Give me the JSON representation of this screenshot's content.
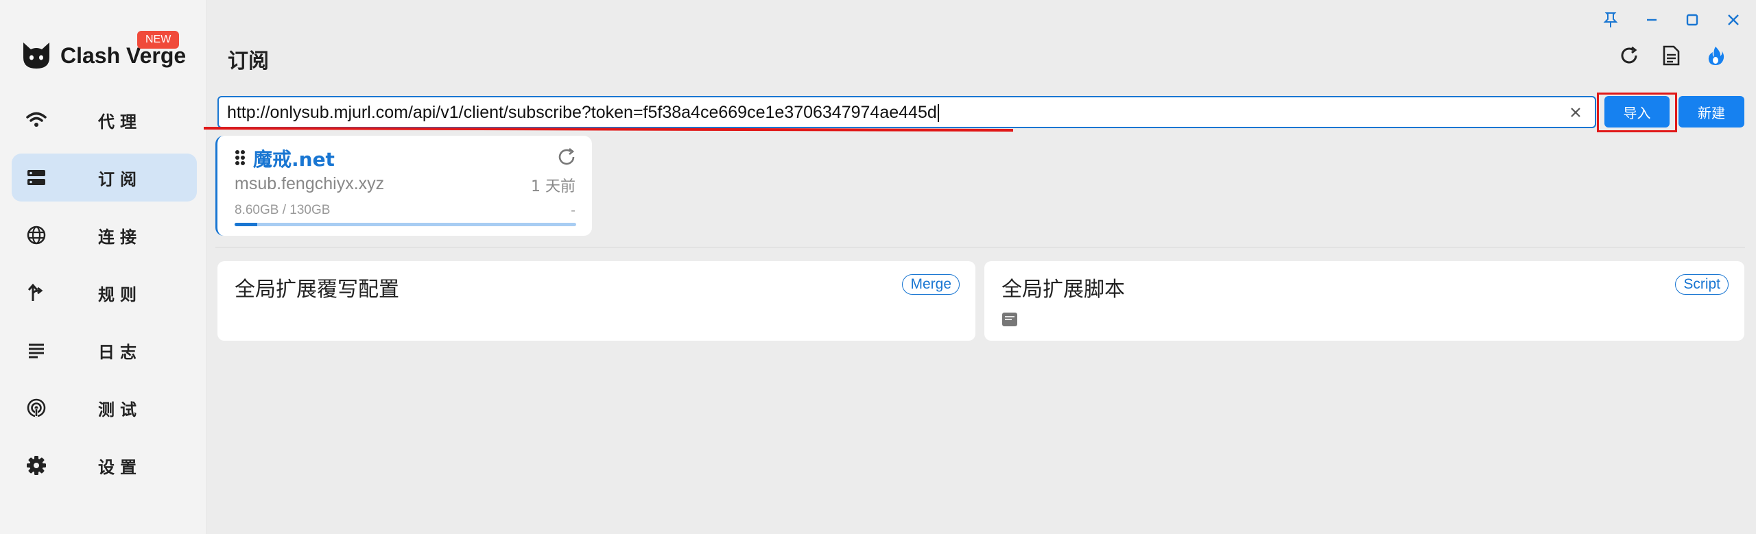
{
  "app": {
    "name": "Clash Verge",
    "new_badge": "NEW"
  },
  "sidebar": {
    "items": [
      {
        "label": "代理",
        "icon": "wifi-icon",
        "active": false
      },
      {
        "label": "订阅",
        "icon": "storage-icon",
        "active": true
      },
      {
        "label": "连接",
        "icon": "globe-icon",
        "active": false
      },
      {
        "label": "规则",
        "icon": "fork-arrow-icon",
        "active": false
      },
      {
        "label": "日志",
        "icon": "list-lines-icon",
        "active": false
      },
      {
        "label": "测试",
        "icon": "radar-icon",
        "active": false
      },
      {
        "label": "设置",
        "icon": "gear-icon",
        "active": false
      }
    ]
  },
  "header": {
    "title": "订阅"
  },
  "url_bar": {
    "value": "http://onlysub.mjurl.com/api/v1/client/subscribe?token=f5f38a4ce669ce1e3706347974ae445d",
    "import_label": "导入",
    "new_label": "新建"
  },
  "profile": {
    "name": "魔戒.net",
    "host": "msub.fengchiyx.xyz",
    "updated": "1 天前",
    "usage": "8.60GB / 130GB",
    "expire": "-",
    "usage_fraction": 0.066
  },
  "global": {
    "merge": {
      "title": "全局扩展覆写配置",
      "chip": "Merge"
    },
    "script": {
      "title": "全局扩展脚本",
      "chip": "Script"
    }
  },
  "colors": {
    "accent": "#1976d2",
    "button": "#1681f0",
    "highlight": "#e01818"
  }
}
